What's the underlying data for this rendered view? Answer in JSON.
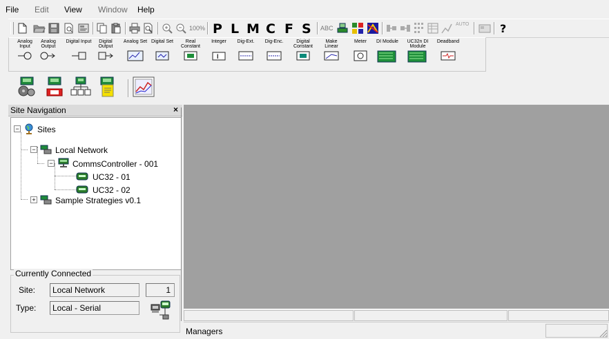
{
  "menu": {
    "file": "File",
    "edit": "Edit",
    "view": "View",
    "window": "Window",
    "help": "Help"
  },
  "toolbar": {
    "zoom_label": "100%",
    "mode_letters": [
      "P",
      "L",
      "M",
      "C",
      "F",
      "S"
    ],
    "abc_label": "ABC",
    "auto_label": "AUTO"
  },
  "blocks": [
    {
      "label": "Analog Input"
    },
    {
      "label": "Analog Output"
    },
    {
      "label": "Digital Input"
    },
    {
      "label": "Digital Output"
    },
    {
      "label": "Analog Set"
    },
    {
      "label": "Digital Set"
    },
    {
      "label": "Real Constant"
    },
    {
      "label": "Integer"
    },
    {
      "label": "Dig-Ext."
    },
    {
      "label": "Dig-Enc."
    },
    {
      "label": "Digital Constant"
    },
    {
      "label": "Make Linear"
    },
    {
      "label": "Meter"
    },
    {
      "label": "DI Module"
    },
    {
      "label": "UC32n DI Module"
    },
    {
      "label": "Deadband"
    }
  ],
  "nav": {
    "title": "Site Navigation",
    "close": "×",
    "tree": {
      "sites": "Sites",
      "local_network": "Local Network",
      "comms_controller": "CommsController - 001",
      "uc32_01": "UC32 - 01",
      "uc32_02": "UC32 - 02",
      "sample": "Sample Strategies v0.1"
    }
  },
  "connected": {
    "legend": "Currently Connected",
    "site_label": "Site:",
    "site_value": "Local Network",
    "site_count": "1",
    "type_label": "Type:",
    "type_value": "Local - Serial"
  },
  "bottom": {
    "managers": "Managers"
  },
  "colors": {
    "mdi_bg": "#a0a0a0",
    "tree_bg": "#ffffff",
    "block_green": "#1e8f3a",
    "block_teal": "#0a8a7a",
    "letter_color": "#000000",
    "controller_green": "#2a7a2a"
  }
}
